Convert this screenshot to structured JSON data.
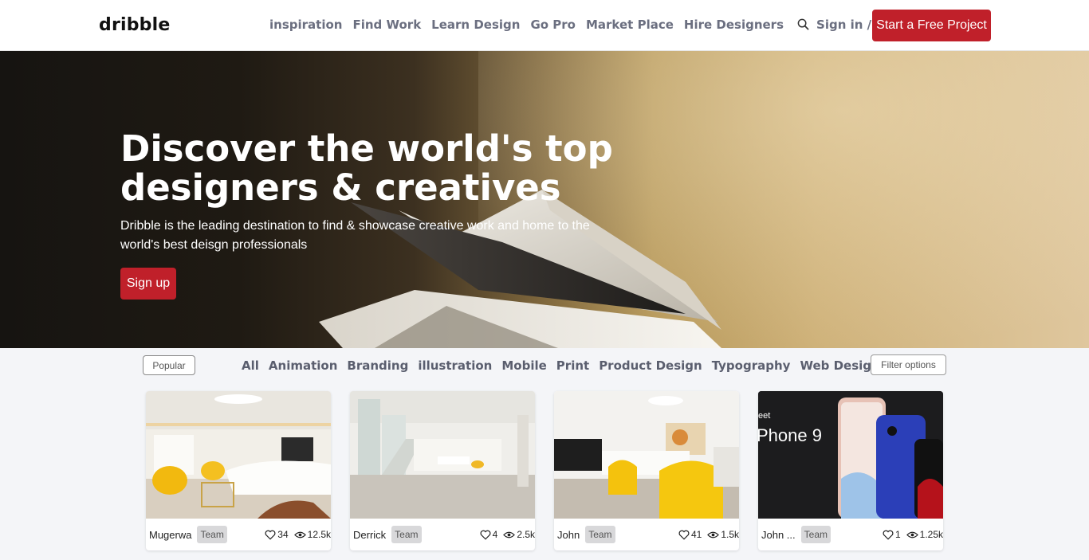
{
  "header": {
    "logo": "dribble",
    "nav": [
      "inspiration",
      "Find Work",
      "Learn Design",
      "Go Pro",
      "Market Place",
      "Hire Designers"
    ],
    "signin": "Sign in / Sign up",
    "cta": "Start a Free Project",
    "search_icon": "search-icon"
  },
  "hero": {
    "title": "Discover the world's top designers & creatives",
    "subtitle": "Dribble is the leading destination to find & showcase creative work and home to the world's best deisgn professionals",
    "signup": "Sign up"
  },
  "filters": {
    "popular": "Popular",
    "categories": [
      "All",
      "Animation",
      "Branding",
      "illustration",
      "Mobile",
      "Print",
      "Product Design",
      "Typography",
      "Web Design"
    ],
    "filter_options": "Filter options"
  },
  "cards": [
    {
      "author": "Mugerwa",
      "badge": "Team",
      "likes": "34",
      "views": "12.5k",
      "thumb_text": ""
    },
    {
      "author": "Derrick",
      "badge": "Team",
      "likes": "4",
      "views": "2.5k",
      "thumb_text": ""
    },
    {
      "author": "John",
      "badge": "Team",
      "likes": "41",
      "views": "1.5k",
      "thumb_text": ""
    },
    {
      "author": "John ...",
      "badge": "Team",
      "likes": "1",
      "views": "1.25k",
      "thumb_text": "Phone 9",
      "thumb_small": "eet"
    }
  ],
  "colors": {
    "accent": "#c0202a",
    "nav_text": "#6b6f80",
    "page_bg": "#f4f5f8"
  }
}
